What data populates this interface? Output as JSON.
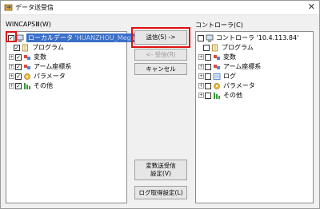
{
  "window": {
    "title": "データ送受信",
    "close_symbol": "✕"
  },
  "left_panel": {
    "label": "WINCAPSⅢ(W)",
    "tree": [
      {
        "label": "ローカルデータ",
        "extra": "'HUANZHOU_Mega",
        "icon": "computer-icon",
        "expander": "",
        "checked": true,
        "selected": true
      },
      {
        "label": "プログラム",
        "icon": "program-file-icon",
        "expander": "",
        "checked": true
      },
      {
        "label": "変数",
        "icon": "variable-icon",
        "expander": "+",
        "checked": true
      },
      {
        "label": "アーム座標系",
        "icon": "arm-coordinate-icon",
        "expander": "+",
        "checked": true
      },
      {
        "label": "パラメータ",
        "icon": "parameter-icon",
        "expander": "+",
        "checked": true
      },
      {
        "label": "その他",
        "icon": "other-icon",
        "expander": "+",
        "checked": true
      }
    ]
  },
  "buttons": {
    "send": "送信(S) ->",
    "receive": "<- 受信(R)",
    "cancel": "キャンセル",
    "var_settings_1": "変数送受信",
    "var_settings_2": "設定(V)",
    "log_settings": "ログ取得設定(L)"
  },
  "right_panel": {
    "label": "コントローラ(C)",
    "tree": [
      {
        "label": "コントローラ '10.4.113.84'",
        "icon": "computer-icon",
        "expander": "",
        "checked": false
      },
      {
        "label": "プログラム",
        "icon": "program-file-icon",
        "expander": "",
        "checked": false
      },
      {
        "label": "変数",
        "icon": "variable-icon",
        "expander": "+",
        "checked": false
      },
      {
        "label": "アーム座標系",
        "icon": "arm-coordinate-icon",
        "expander": "+",
        "checked": false
      },
      {
        "label": "ログ",
        "icon": "log-icon",
        "expander": "+",
        "checked": false
      },
      {
        "label": "パラメータ",
        "icon": "parameter-icon",
        "expander": "+",
        "checked": false
      },
      {
        "label": "その他",
        "icon": "other-icon",
        "expander": "+",
        "checked": false
      }
    ]
  },
  "colors": {
    "highlight_red": "#e01010",
    "selection_blue": "#3a6fc8"
  }
}
